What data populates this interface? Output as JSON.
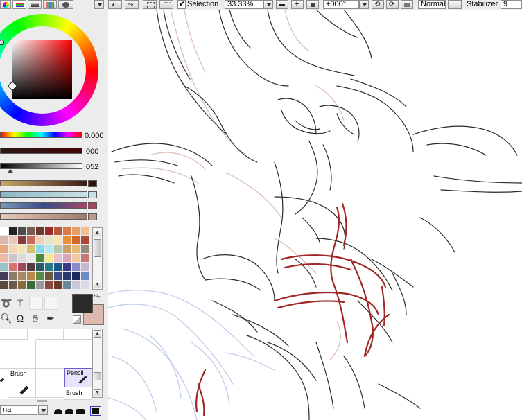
{
  "toolbar": {
    "selection_label": "Selection",
    "selection_checked": true,
    "zoom_value": "33.33%",
    "rotation_value": "+000°",
    "blend_mode": "Normal",
    "stabilizer_label": "Stabilizer",
    "stabilizer_value": "9"
  },
  "color_panel": {
    "hue_value": "0:000",
    "saturation_value": "000",
    "value_value": "052",
    "main_color": "#2a2a2a",
    "secondary_color": "#dfb8ad"
  },
  "swatches": [
    "#ffffff",
    "#222222",
    "#4c4c4c",
    "#7a5a52",
    "#6b3b2a",
    "#9a2a2a",
    "#b8553a",
    "#d87a4a",
    "#e8a06a",
    "#f0c090",
    "#dcb7a8",
    "#e8c8b8",
    "#8a3a3a",
    "#c86a5a",
    "#ecd0b8",
    "#e8e2c8",
    "#f7e6b0",
    "#e8903a",
    "#d06a2a",
    "#b0483a",
    "#e8a878",
    "#f6d6b0",
    "#f2e4b8",
    "#d8c06a",
    "#88d8e8",
    "#b8e8f0",
    "#b8c8a8",
    "#c8a068",
    "#e8b878",
    "#9a8a7a",
    "#f0b8a8",
    "#c8c8c8",
    "#dcdcdc",
    "#e8e8e8",
    "#4a8a3a",
    "#f4e890",
    "#e8c0d0",
    "#d8a8b8",
    "#f2c8a0",
    "#c87878",
    "#9ac0c8",
    "#d87070",
    "#a04858",
    "#5a3a3a",
    "#2a5a6a",
    "#2a7888",
    "#1a5a8a",
    "#3a3a8a",
    "#8a8ac8",
    "#c8b8d8",
    "#4a3a5a",
    "#8a7a6a",
    "#a88868",
    "#b88848",
    "#5a8a4a",
    "#6a5a3a",
    "#3a4a8a",
    "#2a3a6a",
    "#1a2a5a",
    "#6a8ac8",
    "#5a4a3a",
    "#6a5a4a",
    "#8a6a3a",
    "#3a6a3a",
    "#9a9a9a",
    "#8a4a3a",
    "#6a3a2a",
    "#6a8a9a",
    "#cac8d8",
    "#dcd8e8"
  ],
  "tools": [
    {
      "name": "Brush",
      "col": 0,
      "row": 1
    },
    {
      "name": "Pencil",
      "col": 2,
      "row": 1
    },
    {
      "name": "Brush",
      "col": 2,
      "row": 2
    }
  ],
  "layer_panel": {
    "blend_mode_partial": "nal"
  }
}
